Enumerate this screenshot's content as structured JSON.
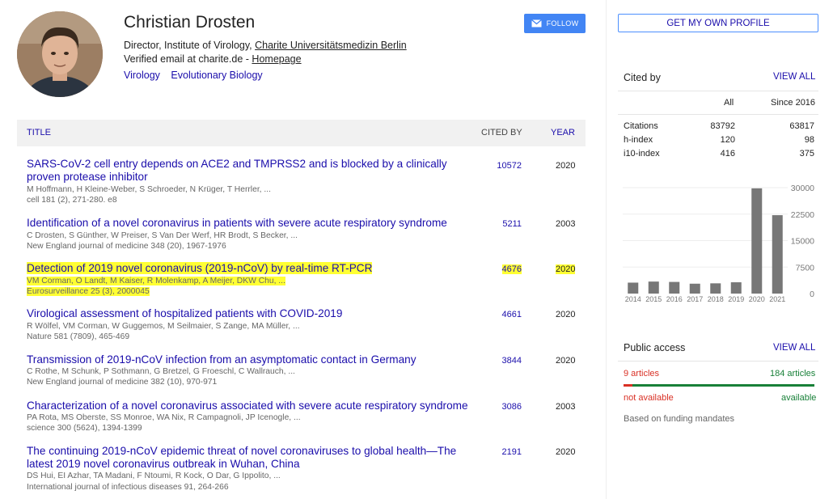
{
  "profile": {
    "name": "Christian Drosten",
    "affiliation_prefix": "Director, Institute of Virology, ",
    "affiliation_link": "Charite Universitätsmedizin Berlin",
    "email_prefix": "Verified email at charite.de - ",
    "homepage_label": "Homepage",
    "interests": [
      "Virology",
      "Evolutionary Biology"
    ],
    "follow_label": "FOLLOW"
  },
  "table": {
    "headers": {
      "title": "TITLE",
      "cited_by": "CITED BY",
      "year": "YEAR"
    },
    "rows": [
      {
        "title": "SARS-CoV-2 cell entry depends on ACE2 and TMPRSS2 and is blocked by a clinically proven protease inhibitor",
        "authors": "M Hoffmann, H Kleine-Weber, S Schroeder, N Krüger, T Herrler, ...",
        "journal": "cell 181 (2), 271-280. e8",
        "cited": "10572",
        "year": "2020",
        "highlight": false
      },
      {
        "title": "Identification of a novel coronavirus in patients with severe acute respiratory syndrome",
        "authors": "C Drosten, S Günther, W Preiser, S Van Der Werf, HR Brodt, S Becker, ...",
        "journal": "New England journal of medicine 348 (20), 1967-1976",
        "cited": "5211",
        "year": "2003",
        "highlight": false
      },
      {
        "title": "Detection of 2019 novel coronavirus (2019-nCoV) by real-time RT-PCR",
        "authors": "VM Corman, O Landt, M Kaiser, R Molenkamp, A Meijer, DKW Chu, ...",
        "journal": "Eurosurveillance 25 (3), 2000045",
        "cited": "4676",
        "year": "2020",
        "highlight": true
      },
      {
        "title": "Virological assessment of hospitalized patients with COVID-2019",
        "authors": "R Wölfel, VM Corman, W Guggemos, M Seilmaier, S Zange, MA Müller, ...",
        "journal": "Nature 581 (7809), 465-469",
        "cited": "4661",
        "year": "2020",
        "highlight": false
      },
      {
        "title": "Transmission of 2019-nCoV infection from an asymptomatic contact in Germany",
        "authors": "C Rothe, M Schunk, P Sothmann, G Bretzel, G Froeschl, C Wallrauch, ...",
        "journal": "New England journal of medicine 382 (10), 970-971",
        "cited": "3844",
        "year": "2020",
        "highlight": false
      },
      {
        "title": "Characterization of a novel coronavirus associated with severe acute respiratory syndrome",
        "authors": "PA Rota, MS Oberste, SS Monroe, WA Nix, R Campagnoli, JP Icenogle, ...",
        "journal": "science 300 (5624), 1394-1399",
        "cited": "3086",
        "year": "2003",
        "highlight": false
      },
      {
        "title": "The continuing 2019-nCoV epidemic threat of novel coronaviruses to global health—The latest 2019 novel coronavirus outbreak in Wuhan, China",
        "authors": "DS Hui, EI Azhar, TA Madani, F Ntoumi, R Kock, O Dar, G Ippolito, ...",
        "journal": "International journal of infectious diseases 91, 264-266",
        "cited": "2191",
        "year": "2020",
        "highlight": false
      }
    ]
  },
  "sidebar": {
    "get_profile_label": "GET MY OWN PROFILE",
    "cited_by": {
      "title": "Cited by",
      "view_all": "VIEW ALL",
      "col_all": "All",
      "col_since": "Since 2016",
      "metrics": [
        {
          "label": "Citations",
          "all": "83792",
          "since": "63817"
        },
        {
          "label": "h-index",
          "all": "120",
          "since": "98"
        },
        {
          "label": "i10-index",
          "all": "416",
          "since": "375"
        }
      ]
    },
    "public_access": {
      "title": "Public access",
      "view_all": "VIEW ALL",
      "not_available_count": "9 articles",
      "available_count": "184 articles",
      "not_available_label": "not available",
      "available_label": "available",
      "available_fraction": 0.953,
      "note": "Based on funding mandates",
      "colors": {
        "not_available": "#d93025",
        "available": "#188038"
      }
    }
  },
  "chart_data": {
    "type": "bar",
    "categories": [
      "2014",
      "2015",
      "2016",
      "2017",
      "2018",
      "2019",
      "2020",
      "2021"
    ],
    "values": [
      3100,
      3400,
      3300,
      2800,
      2900,
      3200,
      29800,
      22200
    ],
    "ylim": [
      0,
      30000
    ],
    "yticks": [
      "30000",
      "22500",
      "15000",
      "7500",
      "0"
    ],
    "bar_color": "#777777",
    "grid": true
  }
}
